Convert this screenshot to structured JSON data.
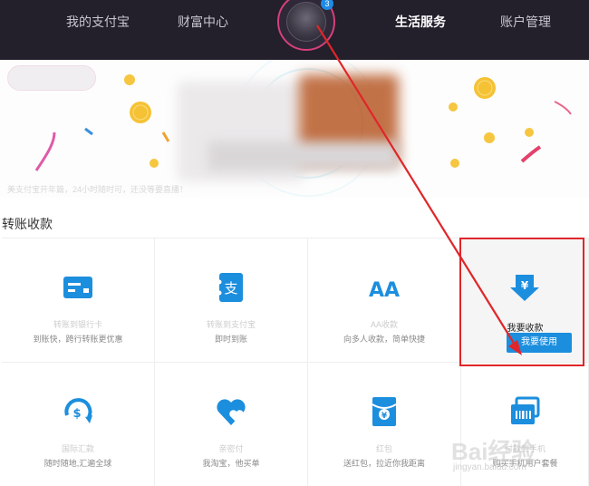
{
  "nav": {
    "items": [
      "我的支付宝",
      "财富中心",
      "生活服务",
      "账户管理"
    ],
    "active": "生活服务",
    "badge_count": "3"
  },
  "banner": {
    "note": "美支付宝开年篇，24小时随时可，还没等要直播！"
  },
  "section": {
    "title": "转账收款"
  },
  "cards": [
    {
      "title": "转账到银行卡",
      "desc": "到账快，跨行转账更优惠",
      "icon": "bank-card-icon"
    },
    {
      "title": "转账到支付宝",
      "desc": "即时到账",
      "icon": "alipay-transfer-icon"
    },
    {
      "title": "AA收款",
      "desc": "向多人收款，简单快捷",
      "icon": "aa-collect-icon"
    },
    {
      "title": "我要收款",
      "desc": "",
      "icon": "receive-money-icon",
      "button": "我要使用"
    },
    {
      "title": "国际汇款",
      "desc": "随时随地,汇遍全球",
      "icon": "global-remit-icon"
    },
    {
      "title": "亲密付",
      "desc": "我淘宝，他买单",
      "icon": "intimate-pay-icon"
    },
    {
      "title": "红包",
      "desc": "送红包，拉近你我距离",
      "icon": "red-packet-icon"
    },
    {
      "title": "付款到手机",
      "desc": "购买手机用户套餐",
      "icon": "pay-phone-icon"
    }
  ],
  "watermark": {
    "text": "Bai经验",
    "sub": "jingyan.baidu.com"
  },
  "colors": {
    "nav_bg": "#231f2b",
    "accent_blue": "#1c8ede",
    "highlight_red": "#e0262a"
  }
}
